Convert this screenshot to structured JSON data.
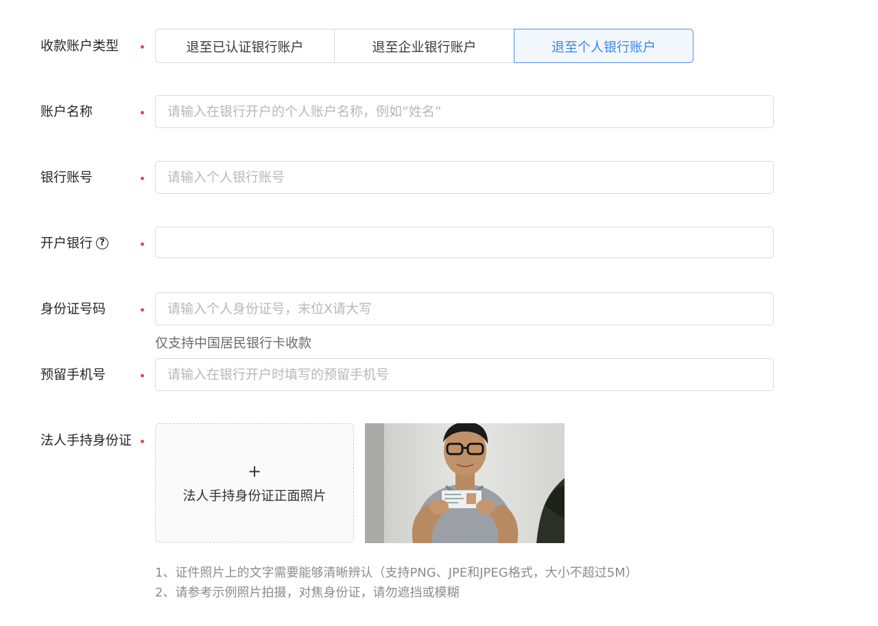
{
  "form": {
    "account_type": {
      "label": "收款账户类型",
      "options": [
        "退至已认证银行账户",
        "退至企业银行账户",
        "退至个人银行账户"
      ],
      "selected": "退至个人银行账户"
    },
    "account_name": {
      "label": "账户名称",
      "placeholder": "请输入在银行开户的个人账户名称，例如“姓名”",
      "value": ""
    },
    "bank_account": {
      "label": "银行账号",
      "placeholder": "请输入个人银行账号",
      "value": ""
    },
    "bank": {
      "label": "开户银行",
      "help_icon": "question-circle-icon",
      "help_glyph": "?",
      "placeholder": "",
      "value": ""
    },
    "id_number": {
      "label": "身份证号码",
      "placeholder": "请输入个人身份证号，末位X请大写",
      "value": "",
      "hint": "仅支持中国居民银行卡收款"
    },
    "phone": {
      "label": "预留手机号",
      "placeholder": "请输入在银行开户时填写的预留手机号",
      "value": ""
    },
    "id_photo": {
      "label": "法人手持身份证",
      "plus_icon": "+",
      "upload_label": "法人手持身份证正面照片",
      "notes": [
        "1、证件照片上的文字需要能够清晰辨认（支持PNG、JPE和JPEG格式，大小不超过5M）",
        "2、请参考示例照片拍摄，对焦身份证，请勿遮挡或模糊"
      ]
    }
  },
  "colors": {
    "required_dot": "#e0464a",
    "accent": "#3c86e6",
    "placeholder": "#b8b8b8",
    "border": "#d9d9d9"
  }
}
